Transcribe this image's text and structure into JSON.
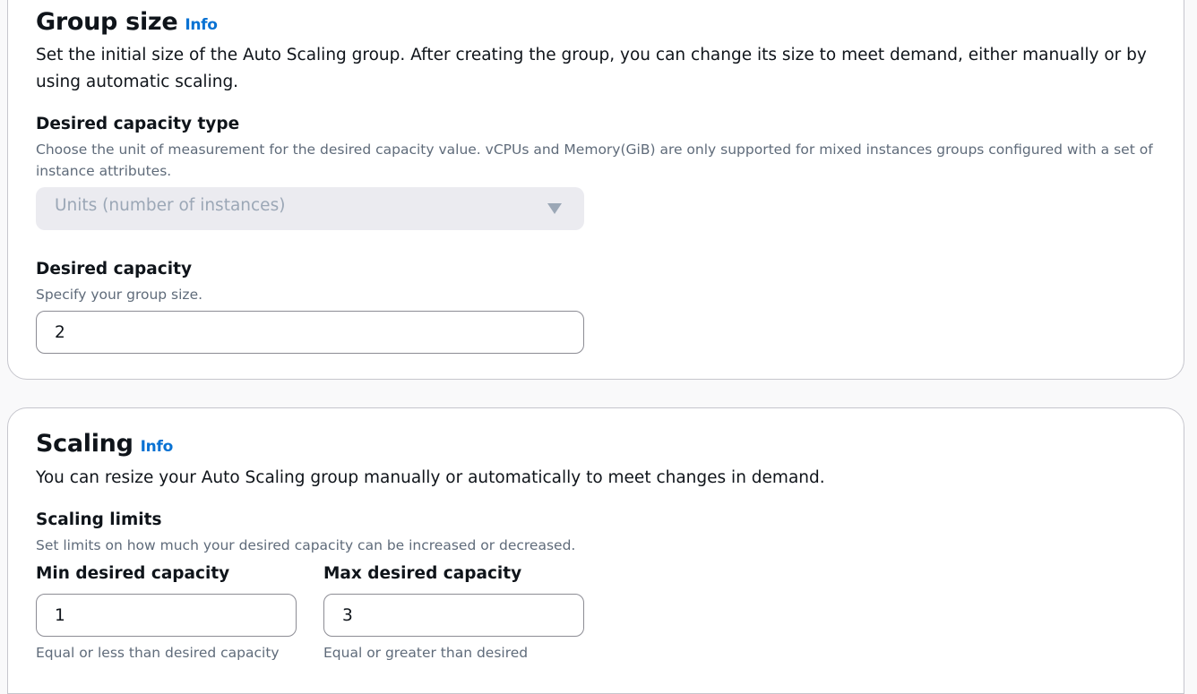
{
  "group_size": {
    "title": "Group size",
    "info_link": "Info",
    "description": "Set the initial size of the Auto Scaling group. After creating the group, you can change its size to meet demand, either manually or by using automatic scaling.",
    "capacity_type": {
      "label": "Desired capacity type",
      "hint": "Choose the unit of measurement for the desired capacity value. vCPUs and Memory(GiB) are only supported for mixed instances groups configured with a set of instance attributes.",
      "selected": "Units (number of instances)",
      "disabled": true
    },
    "desired_capacity": {
      "label": "Desired capacity",
      "hint": "Specify your group size.",
      "value": "2"
    }
  },
  "scaling": {
    "title": "Scaling",
    "info_link": "Info",
    "description": "You can resize your Auto Scaling group manually or automatically to meet changes in demand.",
    "limits": {
      "label": "Scaling limits",
      "hint": "Set limits on how much your desired capacity can be increased or decreased."
    },
    "min": {
      "label": "Min desired capacity",
      "value": "1",
      "hint": "Equal or less than desired capacity"
    },
    "max": {
      "label": "Max desired capacity",
      "value": "3",
      "hint": "Equal or greater than desired"
    }
  },
  "colors": {
    "link": "#0972d3",
    "text": "#0f141a",
    "hint": "#5f6b7a",
    "disabled_bg": "#ebebf0",
    "border": "#8c8c94"
  },
  "icons": {
    "select_caret": "caret-down-icon"
  }
}
